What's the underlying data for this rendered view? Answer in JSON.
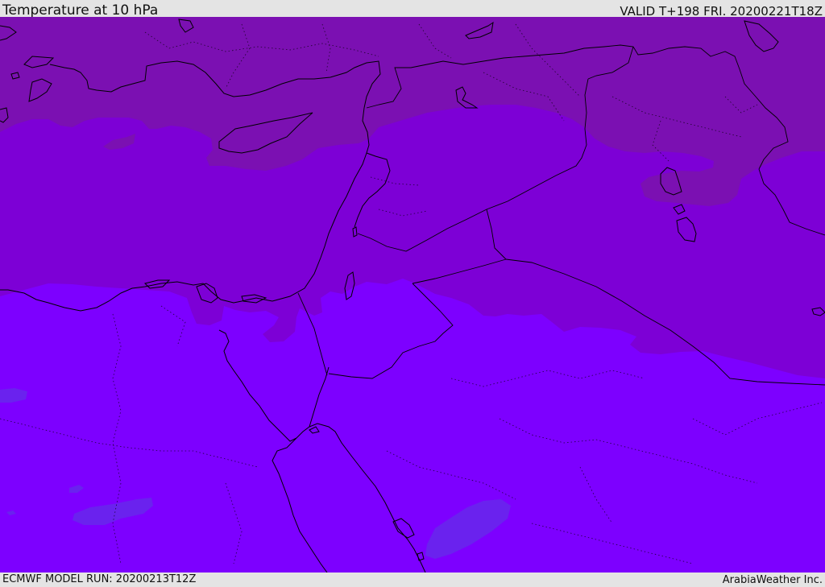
{
  "header": {
    "title": "Temperature at 10 hPa",
    "valid": "VALID T+198 FRI. 20200221T18Z"
  },
  "footer": {
    "model_run": "ECMWF MODEL RUN: 20200213T12Z",
    "credit": "ArabiaWeather Inc."
  },
  "map": {
    "fill_colors": {
      "coldest_band": "#7b10b2",
      "cold_band": "#7d00d6",
      "base_band": "#7d00ff",
      "warm_patch": "#6a22ee"
    },
    "coastline_color": "#000000",
    "border_color": "#000000"
  }
}
